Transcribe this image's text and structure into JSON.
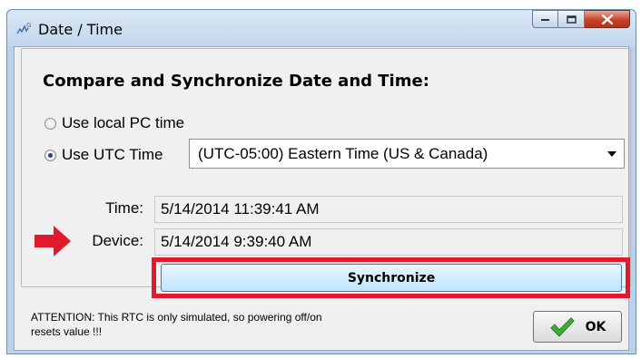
{
  "window": {
    "title": "Date / Time",
    "icon_name": "chart-g-icon"
  },
  "controls": {
    "minimize_icon": "minimize-icon",
    "maximize_icon": "maximize-icon",
    "close_icon": "close-icon"
  },
  "panel": {
    "heading": "Compare and Synchronize Date and Time:",
    "option_local": "Use local PC time",
    "option_utc": "Use UTC Time",
    "selected_option": "utc",
    "timezone": {
      "value": "(UTC-05:00) Eastern Time (US & Canada)"
    },
    "time_label": "Time:",
    "time_value": "5/14/2014 11:39:41 AM",
    "device_label": "Device:",
    "device_value": "5/14/2014 9:39:40 AM",
    "synchronize_label": "Synchronize"
  },
  "footer": {
    "attention_text": "ATTENTION: This RTC is only simulated, so powering off/on resets value !!!",
    "ok_label": "OK"
  },
  "colors": {
    "highlight": "#e0192c",
    "ok_check": "#3cae33"
  }
}
